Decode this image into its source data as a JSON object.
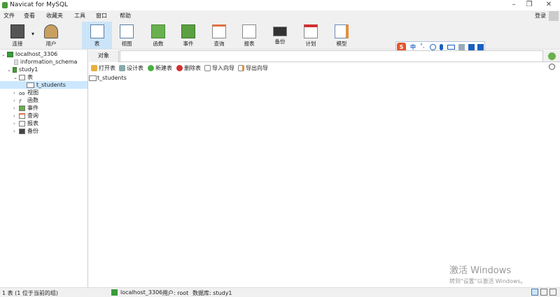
{
  "window": {
    "title": "Navicat for MySQL",
    "minimize": "–",
    "restore": "❐",
    "close": "✕"
  },
  "menu": [
    "文件",
    "查看",
    "收藏夹",
    "工具",
    "窗口",
    "帮助"
  ],
  "login": "登录",
  "toolbar": [
    {
      "label": "连接",
      "icon": "connection-icon"
    },
    {
      "label": "用户",
      "icon": "user-icon"
    },
    {
      "label": "表",
      "icon": "table-icon",
      "selected": true
    },
    {
      "label": "视图",
      "icon": "view-icon"
    },
    {
      "label": "函数",
      "icon": "function-icon"
    },
    {
      "label": "事件",
      "icon": "event-icon"
    },
    {
      "label": "查询",
      "icon": "query-icon"
    },
    {
      "label": "报表",
      "icon": "report-icon"
    },
    {
      "label": "备份",
      "icon": "backup-icon"
    },
    {
      "label": "计划",
      "icon": "schedule-icon"
    },
    {
      "label": "模型",
      "icon": "model-icon"
    }
  ],
  "ime": {
    "logo": "S",
    "mode": "中",
    "punct": "°,"
  },
  "tree": {
    "connection": "localhost_3306",
    "db1": "information_schema",
    "db2": "study1",
    "tables": "表",
    "table1": "t_students",
    "views": "视图",
    "functions": "函数",
    "events": "事件",
    "queries": "查询",
    "reports": "报表",
    "backups": "备份"
  },
  "tabs": {
    "objects": "对象"
  },
  "objbar": [
    "打开表",
    "设计表",
    "新建表",
    "删除表",
    "导入向导",
    "导出向导"
  ],
  "objects": [
    "t_students"
  ],
  "status": {
    "count": "1 表 (1 位于当前的组)",
    "connection": "localhost_3306",
    "user": "用户: root",
    "database": "数据库: study1"
  },
  "watermark": {
    "title": "激活 Windows",
    "sub": "转到\"设置\"以激活 Windows。"
  },
  "colors": {
    "selected": "#cce4f7",
    "bar": "#f0f0f0"
  }
}
